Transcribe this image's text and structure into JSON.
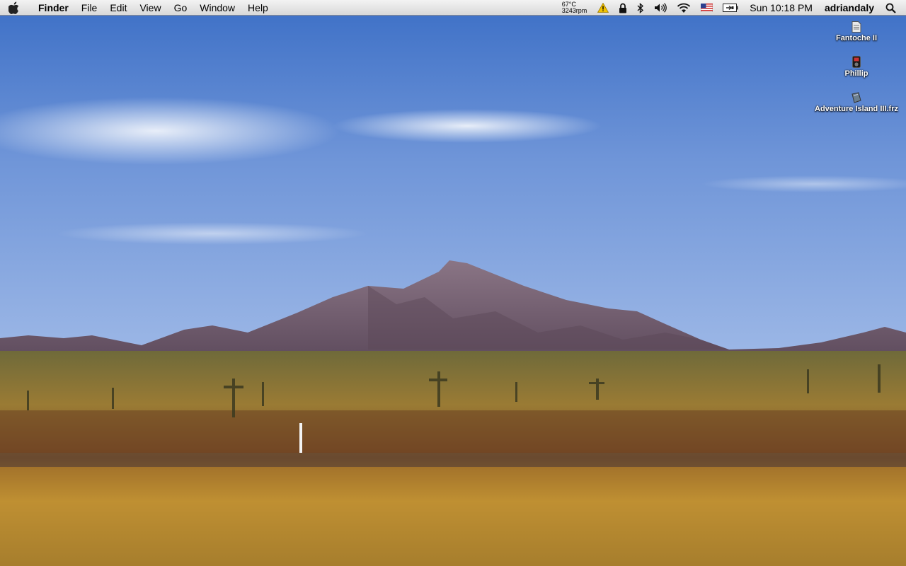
{
  "menubar": {
    "app_name": "Finder",
    "menus": [
      "File",
      "Edit",
      "View",
      "Go",
      "Window",
      "Help"
    ],
    "status": {
      "temperature": "67°C",
      "fan_speed": "3243rpm",
      "clock": "Sun 10:18 PM",
      "user": "adriandaly",
      "icons": [
        "warning-icon",
        "lock-icon",
        "bluetooth-icon",
        "volume-icon",
        "wifi-icon",
        "us-flag-input-icon",
        "battery-icon",
        "spotlight-icon"
      ]
    }
  },
  "desktop": {
    "icons": [
      {
        "label": "Fantoche II",
        "icon": "document-icon"
      },
      {
        "label": "Phillip",
        "icon": "ipod-icon"
      },
      {
        "label": "Adventure Island III.frz",
        "icon": "freeze-file-icon"
      }
    ]
  },
  "colors": {
    "sky_top": "#3f73c9",
    "sky_bottom": "#8fb0e6",
    "mountain": "#6e5a70",
    "grass_dark": "#6e5a2a",
    "grass_gold": "#c89a32"
  }
}
